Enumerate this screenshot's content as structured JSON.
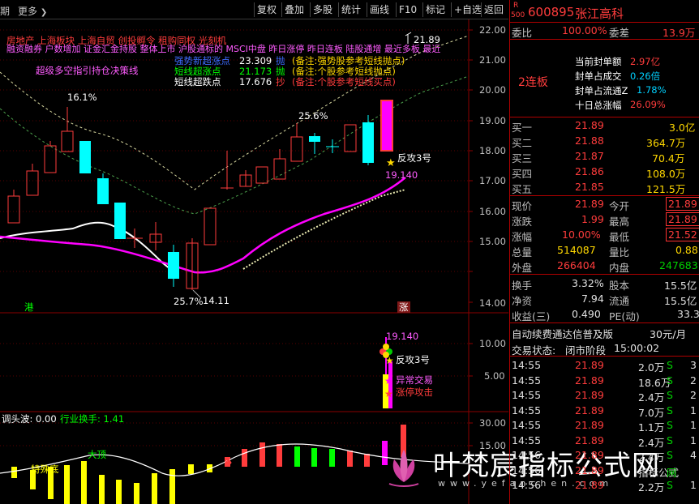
{
  "toolbar": {
    "left_labels": [
      "期",
      "更多"
    ],
    "more_arrow": "❯",
    "buttons": [
      "复权",
      "叠加",
      "多股",
      "统计",
      "画线",
      "F10",
      "标记",
      "+自选",
      "返回"
    ]
  },
  "price_axis": {
    "labels": [
      "22.00",
      "21.00",
      "20.00",
      "19.00",
      "18.00",
      "17.00",
      "16.00",
      "15.00",
      "14.00"
    ]
  },
  "vol_axis": {
    "labels": [
      "10.00",
      "5.00"
    ]
  },
  "osc_axis": {
    "labels": [
      "30.00",
      "15.00"
    ]
  },
  "overlay": {
    "concepts_line1": "房地产    上海板块   上海自贸  创投孵令  租购同权  光刻机",
    "concepts_line2": "融资融券  户数增加  证金汇金持股  整体上市  沪股通标的  MSCI中盘  昨日涨停  昨日连板  陆股通增  最近多板  最近",
    "ind1": {
      "name": "强势新超涨点",
      "value": "23.309",
      "tag": "抛",
      "note": "(备注:强势股参考短线抛点)"
    },
    "ind2": {
      "name": "短线超涨点",
      "value": "21.173",
      "tag": "抛",
      "note": "(备注:个股参考短线抛点)"
    },
    "ind3": {
      "name": "短线超跌点",
      "value": "17.676",
      "tag": "抄",
      "note": "(备注:个股参考短线买点)"
    },
    "signal_text": "超级多空指引持仓决策线",
    "high_label": "21.89",
    "pct1": "16.1%",
    "pct2": "25.6%",
    "pct3": "25.7%",
    "low_label": "14.11",
    "attack3": "反攻3号",
    "magenta_val": "19.140",
    "gang": "港",
    "zhang": "涨",
    "vol_magenta_val": "19.140",
    "vol_attack3": "反攻3号",
    "abnormal": "异常交易",
    "limit_up": "涨停攻击",
    "osc_title1": "调头波: 0.00",
    "osc_title2": "行业换手: 1.41",
    "tejiang": "特殊底",
    "dading": "大顶"
  },
  "watermark": {
    "cn": "叶梵宸指标公式网",
    "url": "www.yefanchen.com"
  },
  "panel": {
    "r_badge": "R",
    "code_num": "500",
    "code": "600895",
    "name": "张江高科",
    "weibi_label": "委比",
    "weibi_value": "100.00%",
    "weicha_label": "委差",
    "weicha_value": "13.9万",
    "seal_amount_label": "当前封单额",
    "seal_amount": "2.97亿",
    "seal_ratio_label": "封单占成交",
    "seal_ratio": "0.26倍",
    "seal_float_label": "封单占流通Z",
    "seal_float": "1.78%",
    "ten_day_label": "十日总涨幅",
    "ten_day": "26.09%",
    "lianban": "2连板",
    "buys": [
      {
        "label": "买一",
        "price": "21.89",
        "vol": "3.0亿"
      },
      {
        "label": "买二",
        "price": "21.88",
        "vol": "364.7万"
      },
      {
        "label": "买三",
        "price": "21.87",
        "vol": "70.4万"
      },
      {
        "label": "买四",
        "price": "21.86",
        "vol": "108.0万"
      },
      {
        "label": "买五",
        "price": "21.85",
        "vol": "121.5万"
      }
    ],
    "stats": [
      {
        "l1": "现价",
        "v1": "21.89",
        "l2": "今开",
        "v2": "21.89"
      },
      {
        "l1": "涨跌",
        "v1": "1.99",
        "l2": "最高",
        "v2": "21.89"
      },
      {
        "l1": "涨幅",
        "v1": "10.00%",
        "l2": "最低",
        "v2": "21.52"
      },
      {
        "l1": "总量",
        "v1": "514087",
        "l2": "量比",
        "v2": "0.88"
      },
      {
        "l1": "外盘",
        "v1": "266404",
        "l2": "内盘",
        "v2": "247683"
      }
    ],
    "stats2": [
      {
        "l1": "换手",
        "v1": "3.32%",
        "l2": "股本",
        "v2": "15.5亿"
      },
      {
        "l1": "净资",
        "v1": "7.94",
        "l2": "流通",
        "v2": "15.5亿"
      },
      {
        "l1": "收益(三)",
        "v1": "0.490",
        "l2": "PE(动)",
        "v2": "33.3"
      }
    ],
    "fee_text": "自动续费通达信普及版",
    "fee_price": "30元/月",
    "status_label": "交易状态:",
    "status_value": "闭市阶段",
    "status_time": "15:00:02",
    "ticks": [
      {
        "t": "14:55",
        "p": "21.89",
        "v": "2.0万",
        "s": "S",
        "n": "3"
      },
      {
        "t": "14:55",
        "p": "21.89",
        "v": "18.6万",
        "s": "S",
        "n": "2"
      },
      {
        "t": "14:55",
        "p": "21.89",
        "v": "2.4万",
        "s": "S",
        "n": "2"
      },
      {
        "t": "14:55",
        "p": "21.89",
        "v": "7.0万",
        "s": "S",
        "n": "1"
      },
      {
        "t": "14:55",
        "p": "21.89",
        "v": "1.1万",
        "s": "S",
        "n": "1"
      },
      {
        "t": "14:55",
        "p": "21.89",
        "v": "2.4万",
        "s": "S",
        "n": "1"
      },
      {
        "t": "14:56",
        "p": "21.89",
        "v": "2.4万",
        "s": "S",
        "n": "4"
      },
      {
        "t": "14:56",
        "p": "21.89",
        "v": "指标公式",
        "s": "网",
        "n": ""
      },
      {
        "t": "14:56",
        "p": "21.89",
        "v": "2.2万",
        "s": "S",
        "n": "1"
      }
    ]
  },
  "colors": {
    "up": "#ff3c3c",
    "down": "#00ffff",
    "magenta": "#ff00ff",
    "yellow": "#ffff00",
    "green": "#00ff00"
  }
}
